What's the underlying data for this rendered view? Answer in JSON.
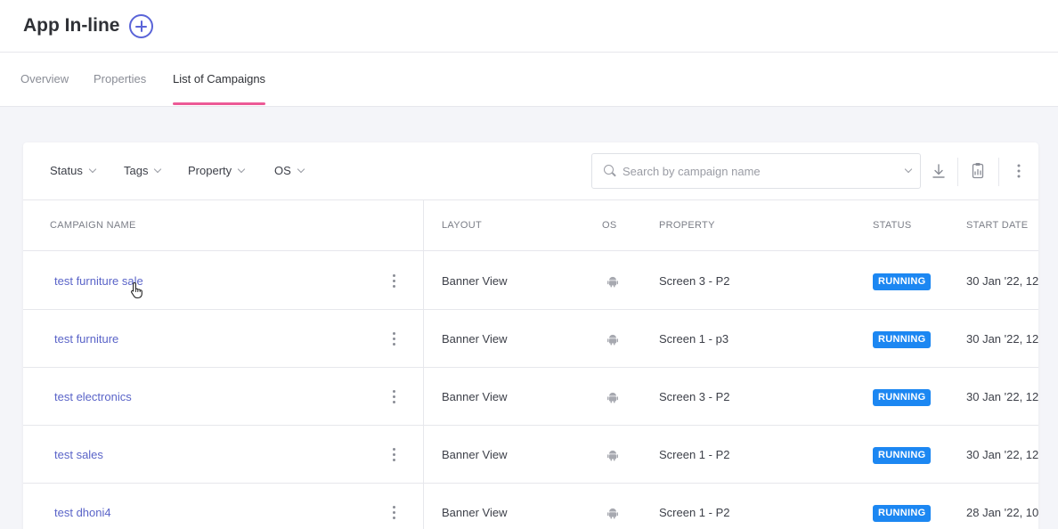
{
  "app": {
    "title": "App In-line"
  },
  "tabs": [
    {
      "label": "Overview"
    },
    {
      "label": "Properties"
    },
    {
      "label": "List of Campaigns",
      "active": true
    }
  ],
  "filters": [
    {
      "label": "Status"
    },
    {
      "label": "Tags"
    },
    {
      "label": "Property"
    },
    {
      "label": "OS"
    }
  ],
  "search": {
    "placeholder": "Search by campaign name",
    "value": ""
  },
  "table": {
    "headers": {
      "campaign_name": "CAMPAIGN NAME",
      "layout": "LAYOUT",
      "os": "OS",
      "property": "PROPERTY",
      "status": "STATUS",
      "start_date": "START DATE"
    },
    "rows": [
      {
        "name": "test furniture sale",
        "layout": "Banner View",
        "os": "android-icon",
        "property": "Screen 3 - P2",
        "status": "RUNNING",
        "start_date": "30 Jan '22, 12"
      },
      {
        "name": "test furniture",
        "layout": "Banner View",
        "os": "android-icon",
        "property": "Screen 1 - p3",
        "status": "RUNNING",
        "start_date": "30 Jan '22, 12"
      },
      {
        "name": "test electronics",
        "layout": "Banner View",
        "os": "android-icon",
        "property": "Screen 3 - P2",
        "status": "RUNNING",
        "start_date": "30 Jan '22, 12"
      },
      {
        "name": "test sales",
        "layout": "Banner View",
        "os": "android-icon",
        "property": "Screen 1 - P2",
        "status": "RUNNING",
        "start_date": "30 Jan '22, 12"
      },
      {
        "name": "test dhoni4",
        "layout": "Banner View",
        "os": "android-icon",
        "property": "Screen 1 - P2",
        "status": "RUNNING",
        "start_date": "28 Jan '22, 10"
      }
    ]
  },
  "colors": {
    "accent": "#5a64d8",
    "tab_underline": "#ec5a96",
    "status_running": "#1c87f2",
    "link": "#5a64c8"
  },
  "icons": [
    "plus-circle-icon",
    "chevron-down-icon",
    "search-icon",
    "download-icon",
    "report-icon",
    "more-vertical-icon",
    "android-icon",
    "hand-pointer-icon"
  ]
}
